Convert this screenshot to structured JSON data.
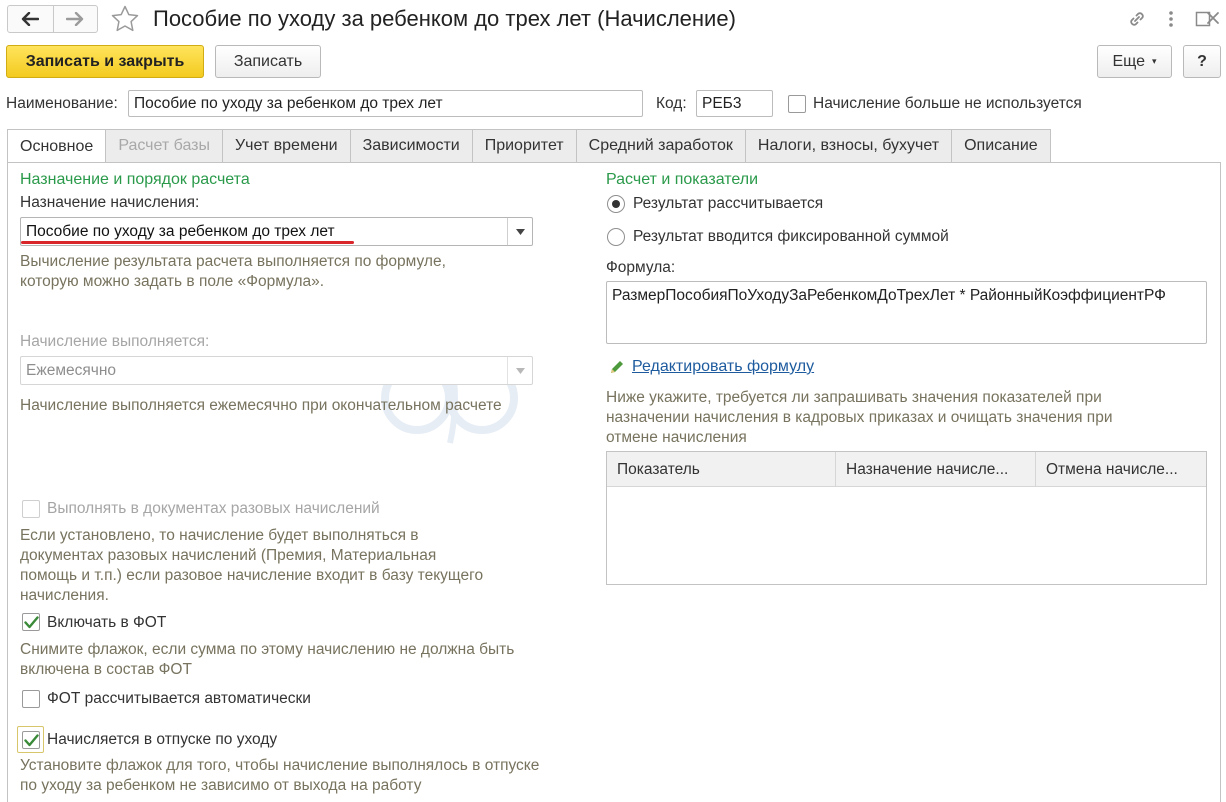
{
  "window": {
    "title": "Пособие по уходу за ребенком до трех лет (Начисление)"
  },
  "toolbar": {
    "save_close_label": "Записать и закрыть",
    "save_label": "Записать",
    "more_label": "Еще",
    "help_label": "?"
  },
  "header": {
    "name_label": "Наименование:",
    "name_value": "Пособие по уходу за ребенком до трех лет",
    "code_label": "Код:",
    "code_value": "РЕБ3",
    "unused_label": "Начисление больше не используется",
    "unused_checked": false
  },
  "tabs": [
    {
      "label": "Основное",
      "active": true,
      "disabled": false
    },
    {
      "label": "Расчет базы",
      "active": false,
      "disabled": true
    },
    {
      "label": "Учет времени",
      "active": false,
      "disabled": false
    },
    {
      "label": "Зависимости",
      "active": false,
      "disabled": false
    },
    {
      "label": "Приоритет",
      "active": false,
      "disabled": false
    },
    {
      "label": "Средний заработок",
      "active": false,
      "disabled": false
    },
    {
      "label": "Налоги, взносы, бухучет",
      "active": false,
      "disabled": false
    },
    {
      "label": "Описание",
      "active": false,
      "disabled": false
    }
  ],
  "left": {
    "section_title": "Назначение и порядок расчета",
    "purpose_label": "Назначение начисления:",
    "purpose_value": "Пособие по уходу за ребенком до трех лет",
    "purpose_hint": "Вычисление результата расчета выполняется по формуле, которую можно задать в поле «Формула».",
    "schedule_label": "Начисление выполняется:",
    "schedule_value": "Ежемесячно",
    "schedule_hint": "Начисление выполняется ежемесячно при окончательном расчете",
    "one_time_label": "Выполнять в документах разовых начислений",
    "one_time_checked": false,
    "one_time_hint": "Если установлено, то начисление будет выполняться в документах разовых начислений (Премия, Материальная помощь и т.п.) если разовое начисление входит в базу текущего начисления.",
    "fot_label": "Включать в ФОТ",
    "fot_checked": true,
    "fot_hint": "Снимите флажок, если сумма по этому начислению не должна быть включена в состав ФОТ",
    "fot_auto_label": "ФОТ рассчитывается автоматически",
    "fot_auto_checked": false,
    "leave_label": "Начисляется в отпуске по уходу",
    "leave_checked": true,
    "leave_hint": "Установите флажок для того, чтобы начисление выполнялось в отпуске по уходу за ребенком не зависимо от выхода на работу"
  },
  "right": {
    "section_title": "Расчет и показатели",
    "radio_calculated": "Результат рассчитывается",
    "radio_fixed": "Результат вводится фиксированной суммой",
    "selected_radio": "calculated",
    "formula_label": "Формула:",
    "formula_value": "РазмерПособияПоУходуЗаРебенкомДоТрехЛет * РайонныйКоэффициентРФ",
    "edit_formula_link": "Редактировать формулу",
    "indicators_hint": "Ниже укажите, требуется ли запрашивать значения показателей при назначении начисления в кадровых приказах и очищать значения при отмене начисления",
    "table_columns": [
      "Показатель",
      "Назначение начисле...",
      "Отмена начисле..."
    ]
  },
  "colors": {
    "section_green": "#2a9a4a",
    "hint_olive": "#77735e",
    "primary_yellow": "#f3cb1f",
    "link_blue": "#1d5b9e",
    "check_green": "#3a8a3a",
    "highlight_red": "#d8262b"
  }
}
